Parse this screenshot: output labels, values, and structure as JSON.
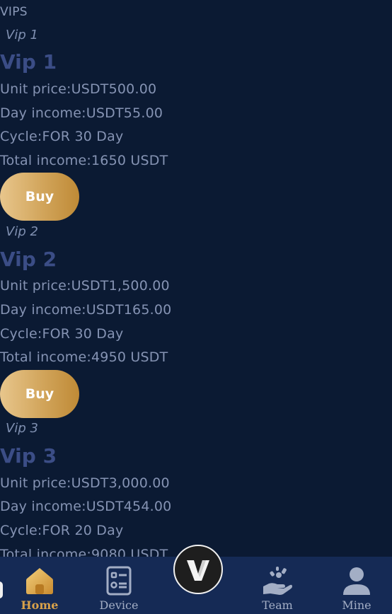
{
  "page": {
    "section_title": "VIPS"
  },
  "plans": [
    {
      "tag": "Vip 1",
      "name": "Vip 1",
      "unit_price": "Unit price:USDT500.00",
      "day_income": "Day income:USDT55.00",
      "cycle": "Cycle:FOR 30 Day",
      "total_income": "Total income:1650 USDT",
      "buy_label": "Buy"
    },
    {
      "tag": "Vip 2",
      "name": "Vip 2",
      "unit_price": "Unit price:USDT1,500.00",
      "day_income": "Day income:USDT165.00",
      "cycle": "Cycle:FOR 30 Day",
      "total_income": "Total income:4950 USDT",
      "buy_label": "Buy"
    },
    {
      "tag": "Vip 3",
      "name": "Vip 3",
      "unit_price": "Unit price:USDT3,000.00",
      "day_income": "Day income:USDT454.00",
      "cycle": "Cycle:FOR 20 Day",
      "total_income": "Total income:9080 USDT"
    }
  ],
  "nav": {
    "home": "Home",
    "device": "Device",
    "team": "Team",
    "mine": "Mine",
    "active": "home"
  },
  "colors": {
    "background": "#0b1a33",
    "nav_background": "#152a55",
    "accent_gold": "#d1a45a",
    "plan_title": "#3b4d86"
  },
  "icons": {
    "home": "home-icon",
    "device": "device-list-icon",
    "center": "v-logo-icon",
    "team": "team-hand-icon",
    "mine": "user-icon"
  }
}
